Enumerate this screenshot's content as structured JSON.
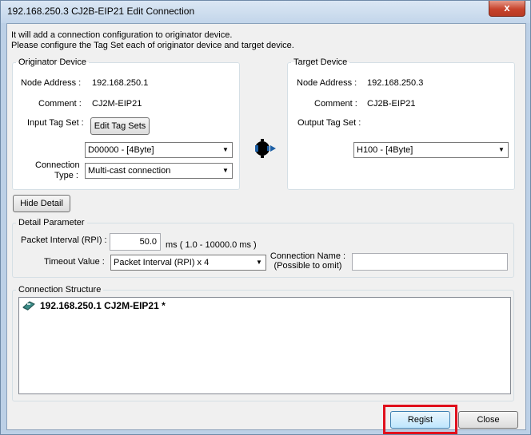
{
  "window": {
    "title": "192.168.250.3 CJ2B-EIP21 Edit Connection",
    "close_glyph": "x"
  },
  "intro": {
    "line1": "It will add a connection configuration to originator device.",
    "line2": "Please configure the Tag Set each of originator device and target device."
  },
  "originator": {
    "legend": "Originator Device",
    "node_label": "Node Address :",
    "node_value": "192.168.250.1",
    "comment_label": "Comment :",
    "comment_value": "CJ2M-EIP21",
    "input_tag_label": "Input Tag Set :",
    "edit_button": "Edit Tag Sets",
    "tag_select": "D00000 - [4Byte]",
    "conn_type_label1": "Connection",
    "conn_type_label2": "Type :",
    "conn_type_select": "Multi-cast connection"
  },
  "target": {
    "legend": "Target Device",
    "node_label": "Node Address :",
    "node_value": "192.168.250.3",
    "comment_label": "Comment :",
    "comment_value": "CJ2B-EIP21",
    "output_tag_label": "Output Tag Set :",
    "tag_select": "H100 - [4Byte]"
  },
  "hide_detail_button": "Hide Detail",
  "detail": {
    "legend": "Detail Parameter",
    "rpi_label": "Packet Interval (RPI) :",
    "rpi_value": "50.0",
    "rpi_unit": "ms ( 1.0 - 10000.0 ms )",
    "timeout_label": "Timeout Value :",
    "timeout_select": "Packet Interval (RPI) x 4",
    "conn_name_label1": "Connection Name :",
    "conn_name_label2": "(Possible to omit)",
    "conn_name_value": ""
  },
  "structure": {
    "legend": "Connection Structure",
    "node_text": "192.168.250.1 CJ2M-EIP21 *"
  },
  "buttons": {
    "regist": "Regist",
    "close": "Close"
  },
  "colors": {
    "highlight": "#e0101c"
  }
}
